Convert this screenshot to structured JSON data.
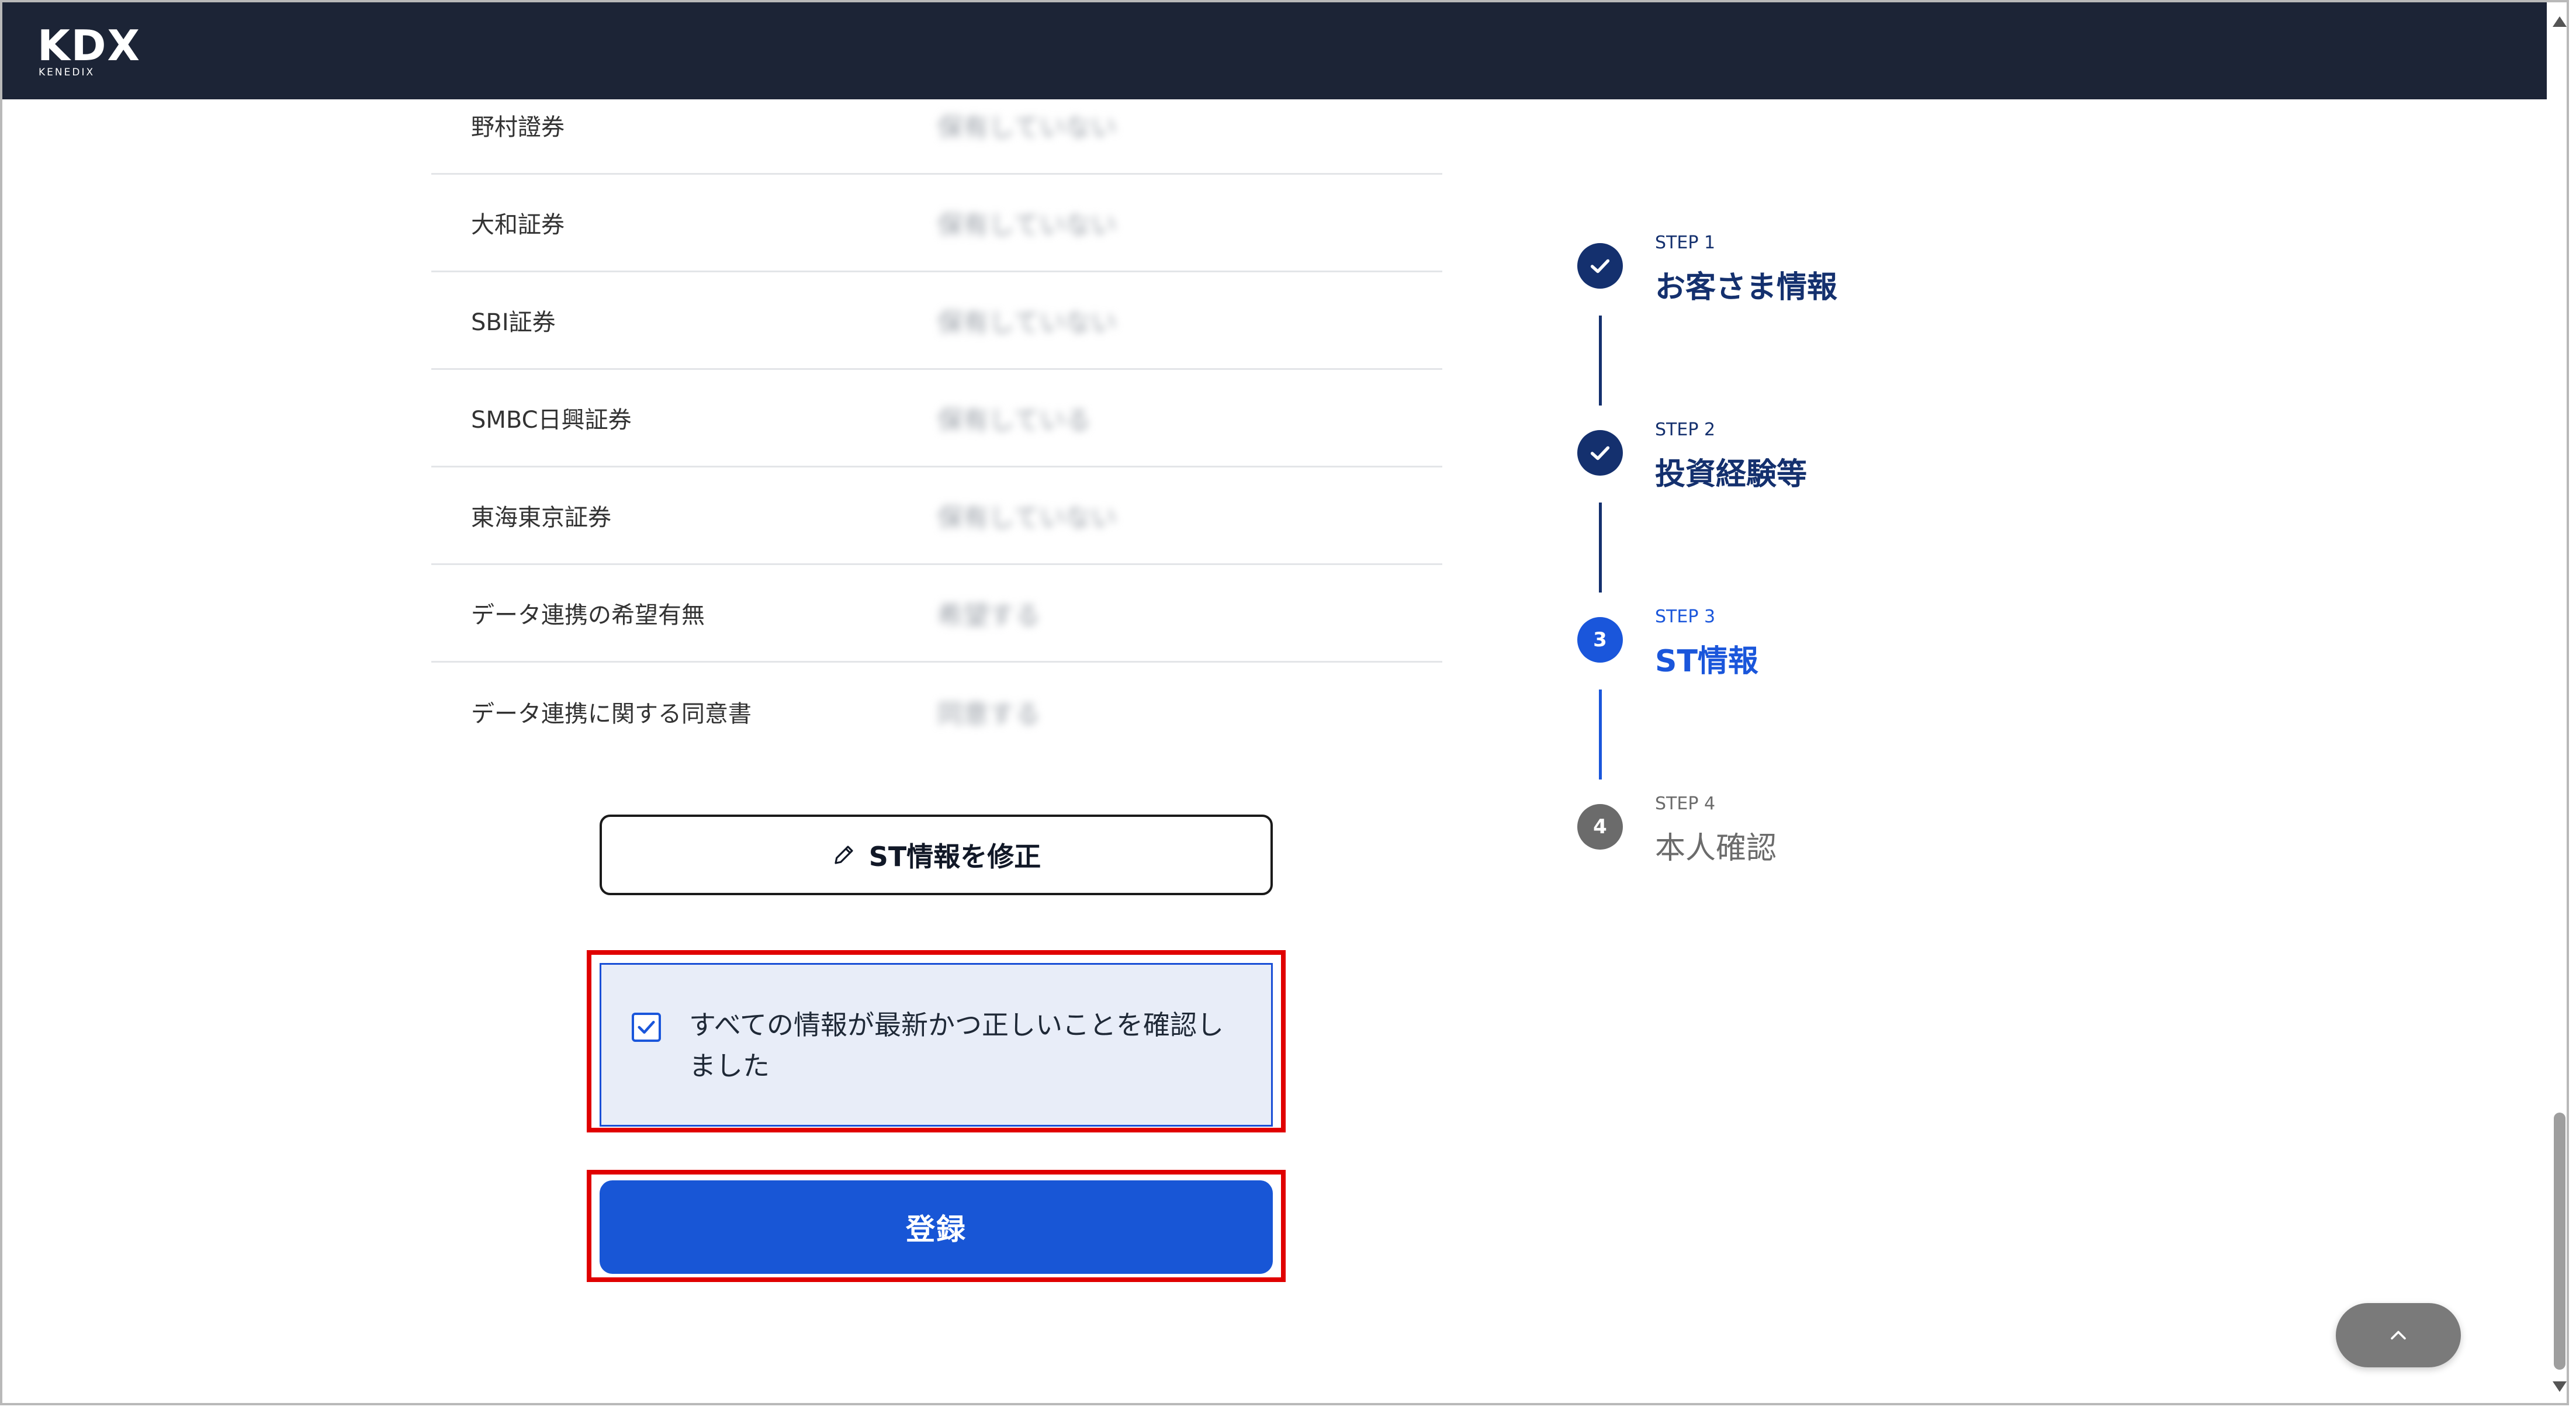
{
  "header": {
    "logo_text": "KDX",
    "logo_subtext": "KENEDIX"
  },
  "table": {
    "rows": [
      {
        "label": "野村證券",
        "value": "保有していない"
      },
      {
        "label": "大和証券",
        "value": "保有していない"
      },
      {
        "label": "SBI証券",
        "value": "保有していない"
      },
      {
        "label": "SMBC日興証券",
        "value": "保有している"
      },
      {
        "label": "東海東京証券",
        "value": "保有していない"
      },
      {
        "label": "データ連携の希望有無",
        "value": "希望する"
      },
      {
        "label": "データ連携に関する同意書",
        "value": "同意する"
      }
    ]
  },
  "edit_button": {
    "label": "ST情報を修正",
    "icon": "pencil-icon"
  },
  "confirm": {
    "checked": true,
    "label": "すべての情報が最新かつ正しいことを確認しました"
  },
  "register_button": {
    "label": "登録"
  },
  "steps": [
    {
      "small": "STEP 1",
      "title": "お客さま情報",
      "state": "done"
    },
    {
      "small": "STEP 2",
      "title": "投資経験等",
      "state": "done"
    },
    {
      "small": "STEP 3",
      "number": "3",
      "title": "ST情報",
      "state": "current"
    },
    {
      "small": "STEP 4",
      "number": "4",
      "title": "本人確認",
      "state": "pending"
    }
  ],
  "colors": {
    "header_bg": "#1c2436",
    "primary": "#1856d6",
    "step_done": "#14306e",
    "highlight": "#e00000",
    "confirm_bg": "#e8edf8"
  },
  "scroll_top_icon": "chevron-up-icon"
}
